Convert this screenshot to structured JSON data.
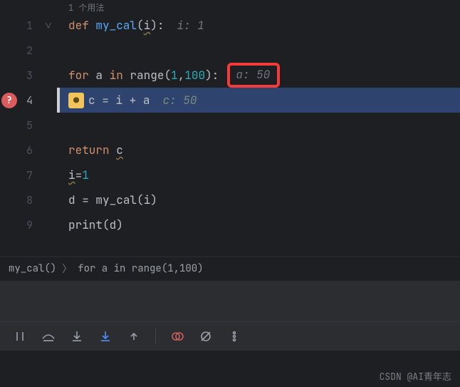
{
  "usages_hint": "1 个用法",
  "lines": [
    {
      "n": "1",
      "fold": "v",
      "tokens": [
        [
          "kw",
          "def "
        ],
        [
          "fn",
          "my_cal"
        ],
        [
          "pn",
          "("
        ],
        [
          "id wavy",
          "i"
        ],
        [
          "pn",
          "):"
        ]
      ],
      "inline": {
        "cls": "hint",
        "text": "i: 1"
      }
    },
    {
      "n": "2"
    },
    {
      "n": "3",
      "indent": "    ",
      "tokens": [
        [
          "kw",
          "for "
        ],
        [
          "id",
          "a"
        ],
        [
          "kw",
          " in "
        ],
        [
          "fn-c",
          "range"
        ],
        [
          "pn",
          "("
        ],
        [
          "num",
          "1"
        ],
        [
          "pn",
          ","
        ],
        [
          "num",
          "100"
        ],
        [
          "pn",
          "):"
        ]
      ],
      "redbox": {
        "label": "a: ",
        "val": "50"
      }
    },
    {
      "n": "4",
      "current": true,
      "bp": true,
      "bulb": true,
      "indent": "        ",
      "tokens": [
        [
          "id",
          "c"
        ],
        [
          "op",
          " = "
        ],
        [
          "id",
          "i"
        ],
        [
          "op",
          " + "
        ],
        [
          "id",
          "a"
        ]
      ],
      "inline": {
        "cls": "hint2",
        "text": "c: 50"
      }
    },
    {
      "n": "5"
    },
    {
      "n": "6",
      "indent": "        ",
      "tokens": [
        [
          "kw",
          "return "
        ],
        [
          "id wavy",
          "c"
        ]
      ]
    },
    {
      "n": "7",
      "tokens": [
        [
          "id wavy",
          "i"
        ],
        [
          "op",
          "="
        ],
        [
          "num",
          "1"
        ]
      ]
    },
    {
      "n": "8",
      "tokens": [
        [
          "id",
          "d"
        ],
        [
          "op",
          " = "
        ],
        [
          "fn-c",
          "my_cal"
        ],
        [
          "pn",
          "("
        ],
        [
          "id",
          "i"
        ],
        [
          "pn",
          ")"
        ]
      ]
    },
    {
      "n": "9",
      "tokens": [
        [
          "fn-c",
          "print"
        ],
        [
          "pn",
          "("
        ],
        [
          "id",
          "d"
        ],
        [
          "pn",
          ")"
        ]
      ]
    }
  ],
  "breadcrumb": {
    "a": "my_cal()",
    "b": "for a in range(1,100)"
  },
  "toolbar_names": [
    "pause",
    "step-over",
    "step-into",
    "step-into-my",
    "step-out",
    "sep",
    "eval",
    "mute",
    "more"
  ],
  "watermark": "CSDN @AI青年志"
}
